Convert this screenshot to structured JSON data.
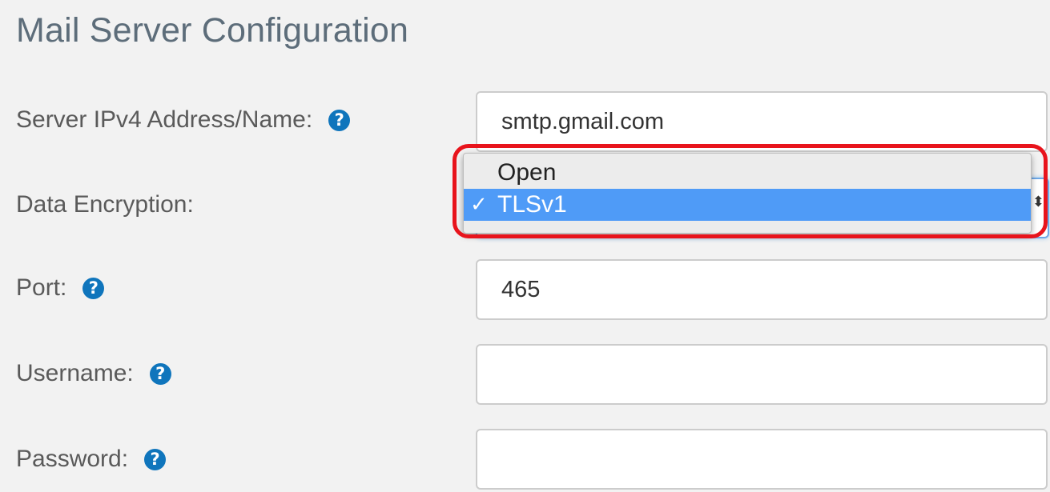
{
  "page": {
    "title": "Mail Server Configuration"
  },
  "fields": {
    "server": {
      "label": "Server IPv4 Address/Name:",
      "value": "smtp.gmail.com"
    },
    "encryption": {
      "label": "Data Encryption:",
      "options": [
        "Open",
        "TLSv1"
      ],
      "selected": "TLSv1",
      "check_glyph": "✓"
    },
    "port": {
      "label": "Port:",
      "value": "465"
    },
    "username": {
      "label": "Username:",
      "value": ""
    },
    "password": {
      "label": "Password:",
      "value": ""
    }
  },
  "help_icon_glyph": "?",
  "select_arrows_glyph": "⬍",
  "colors": {
    "title": "#5d6d7a",
    "help_icon": "#0f75bc",
    "selected_option": "#4f9bf7",
    "highlight": "#e8141c"
  }
}
